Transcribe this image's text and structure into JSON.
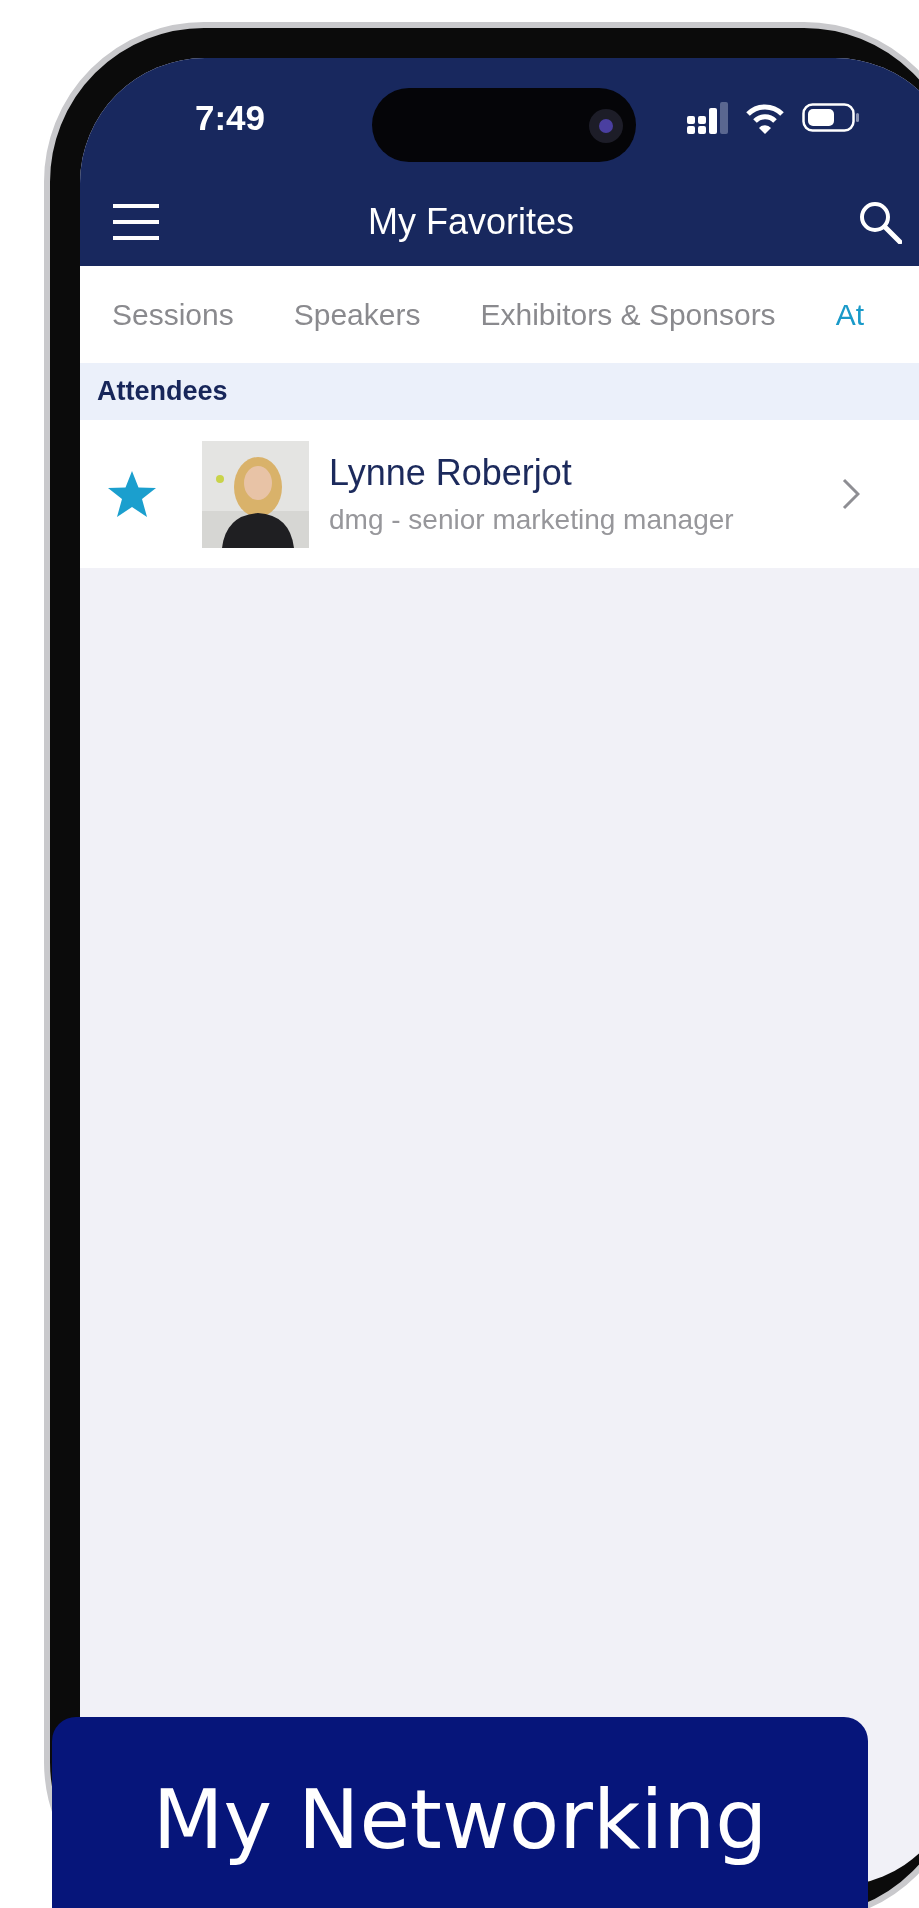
{
  "status_bar": {
    "time": "7:49"
  },
  "nav": {
    "title": "My Favorites"
  },
  "tabs": [
    {
      "label": "Sessions",
      "selected": false
    },
    {
      "label": "Speakers",
      "selected": false
    },
    {
      "label": "Exhibitors & Sponsors",
      "selected": false
    },
    {
      "label": "At",
      "selected": true
    }
  ],
  "section": {
    "title": "Attendees"
  },
  "attendees": [
    {
      "name": "Lynne Roberjot",
      "subtitle": "dmg - senior marketing manager",
      "favorite": true
    }
  ],
  "banner": {
    "text": "My Networking"
  }
}
